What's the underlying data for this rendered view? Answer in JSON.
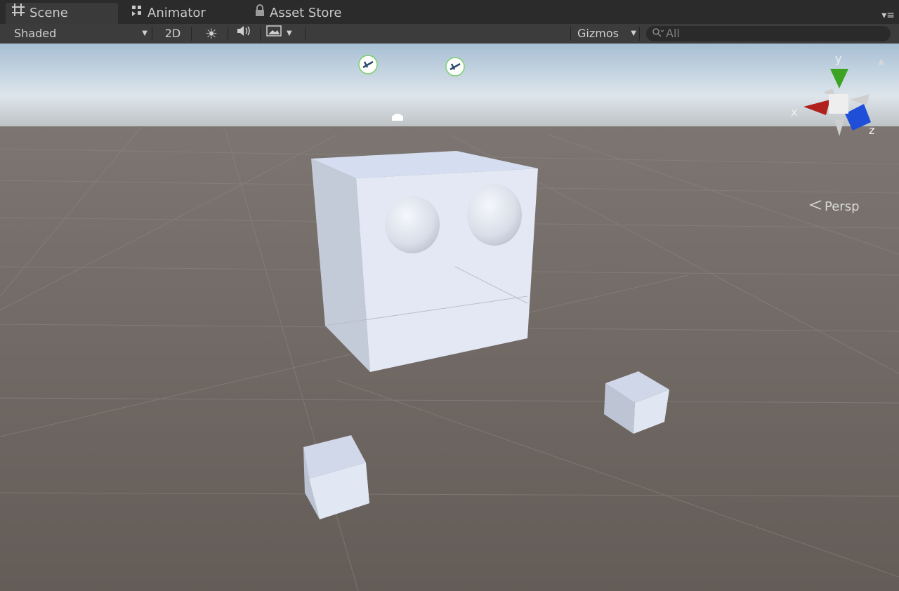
{
  "tabs": [
    {
      "label": "Scene",
      "icon": "grid-icon",
      "active": true
    },
    {
      "label": "Animator",
      "icon": "animator-icon",
      "active": false
    },
    {
      "label": "Asset Store",
      "icon": "lock-icon",
      "active": false
    }
  ],
  "toolbar": {
    "shading_mode": "Shaded",
    "mode_2d_label": "2D",
    "gizmos_label": "Gizmos",
    "search_placeholder": "All"
  },
  "scene": {
    "projection_label": "Persp",
    "axis_labels": {
      "x": "x",
      "y": "y",
      "z": "z"
    }
  },
  "colors": {
    "sky_top": "#9fb8cf",
    "ground": "#6a625d",
    "axis_x": "#b0211d",
    "axis_y": "#3da322",
    "axis_z": "#1f4fd8",
    "object_fill": "#e3e8f4"
  }
}
